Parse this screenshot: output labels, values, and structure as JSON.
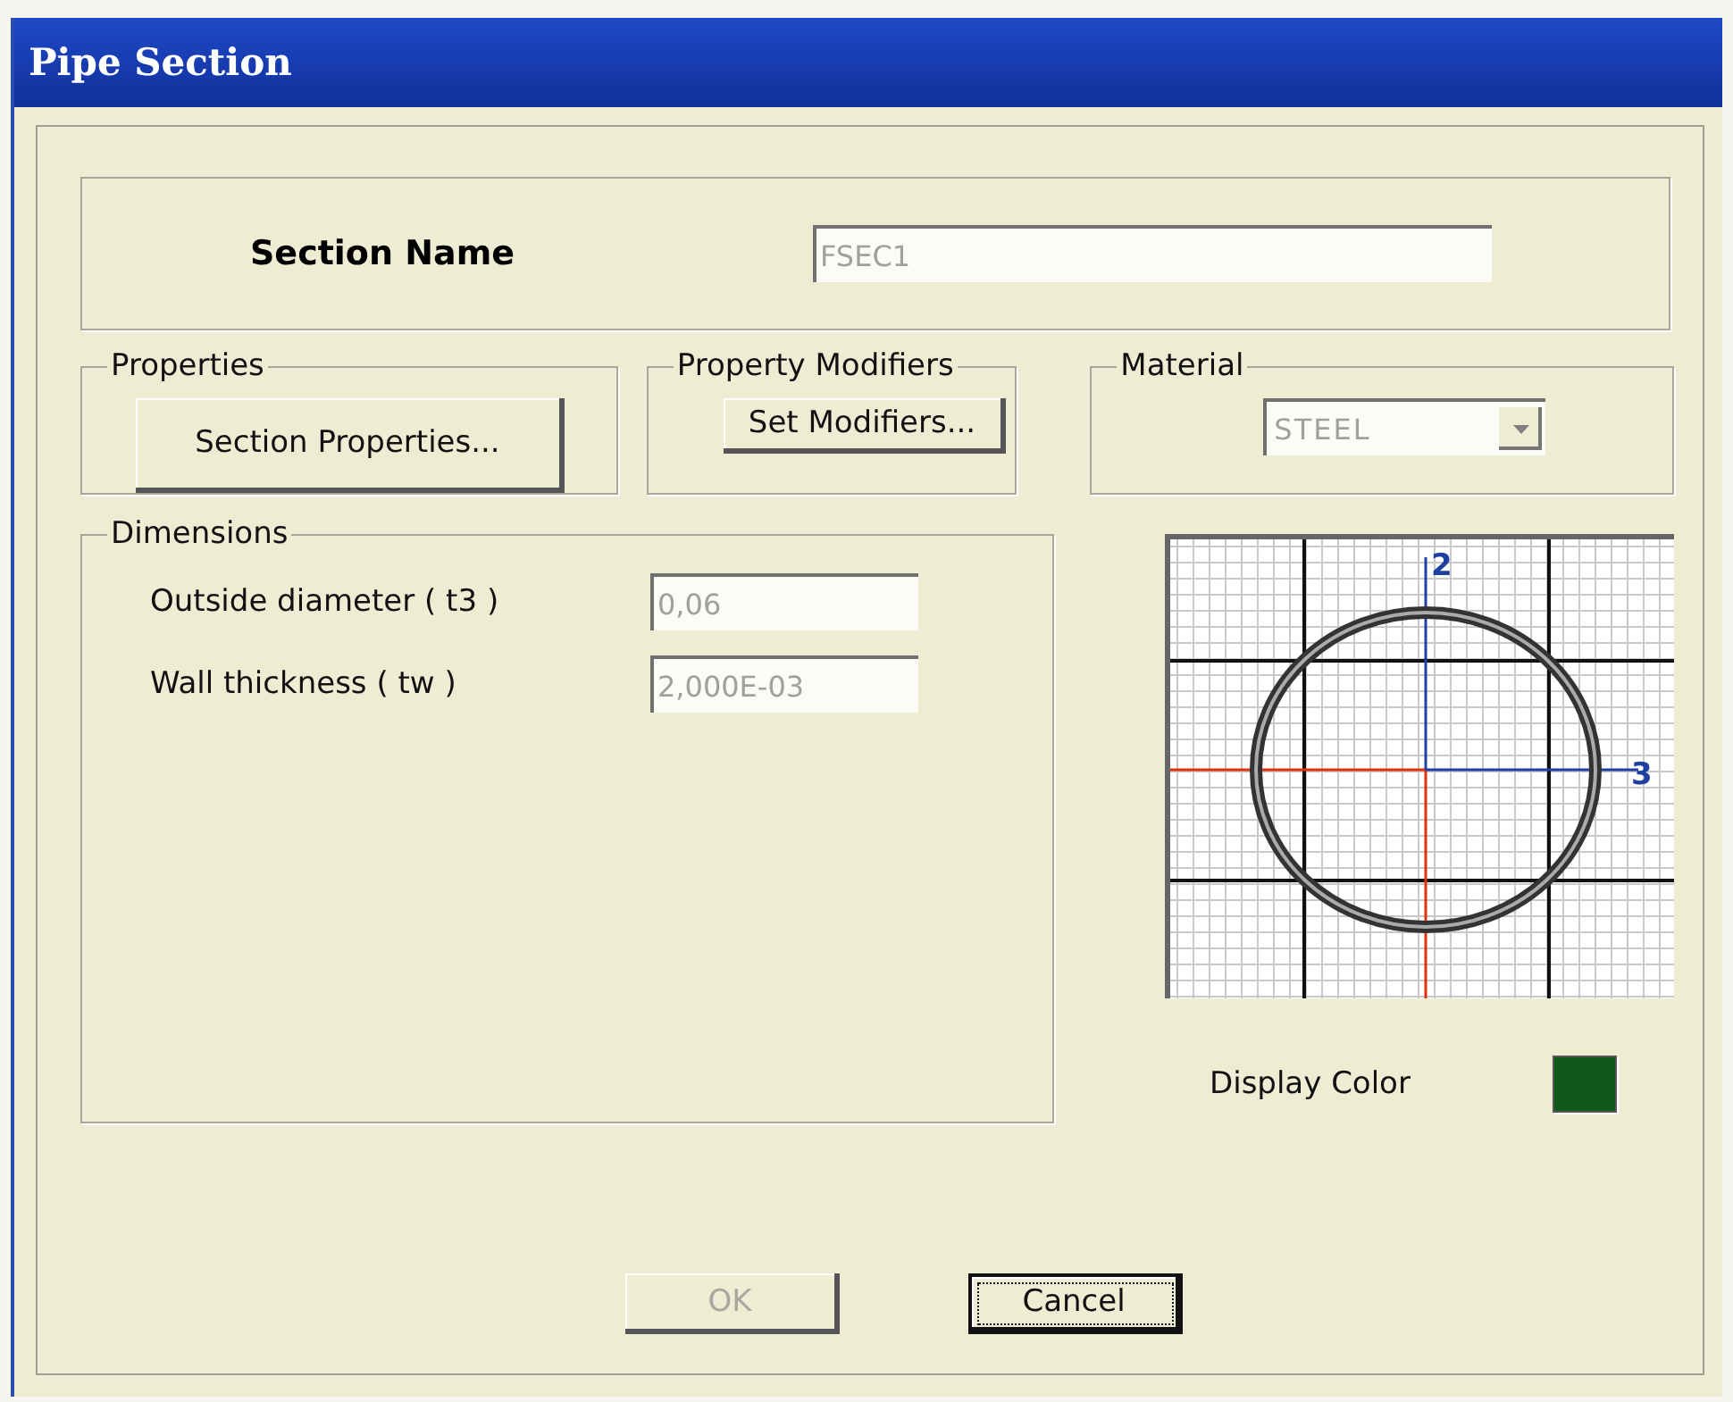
{
  "window": {
    "title": "Pipe Section"
  },
  "section_name": {
    "label": "Section Name",
    "value": "FSEC1",
    "disabled": true
  },
  "properties": {
    "title": "Properties",
    "button": "Section Properties..."
  },
  "property_modifiers": {
    "title": "Property Modifiers",
    "button": "Set Modifiers..."
  },
  "material": {
    "title": "Material",
    "value": "STEEL",
    "disabled": true
  },
  "dimensions": {
    "title": "Dimensions",
    "fields": [
      {
        "label": "Outside diameter  ( t3 )",
        "value": "0,06",
        "disabled": true
      },
      {
        "label": "Wall thickness  ( tw )",
        "value": "2,000E-03",
        "disabled": true
      }
    ]
  },
  "preview": {
    "axis_labels": [
      "2",
      "3"
    ]
  },
  "display_color": {
    "label": "Display Color",
    "color": "#0f5a1a"
  },
  "buttons": [
    {
      "label": "OK",
      "disabled": true,
      "default": false
    },
    {
      "label": "Cancel",
      "disabled": false,
      "default": true
    }
  ]
}
